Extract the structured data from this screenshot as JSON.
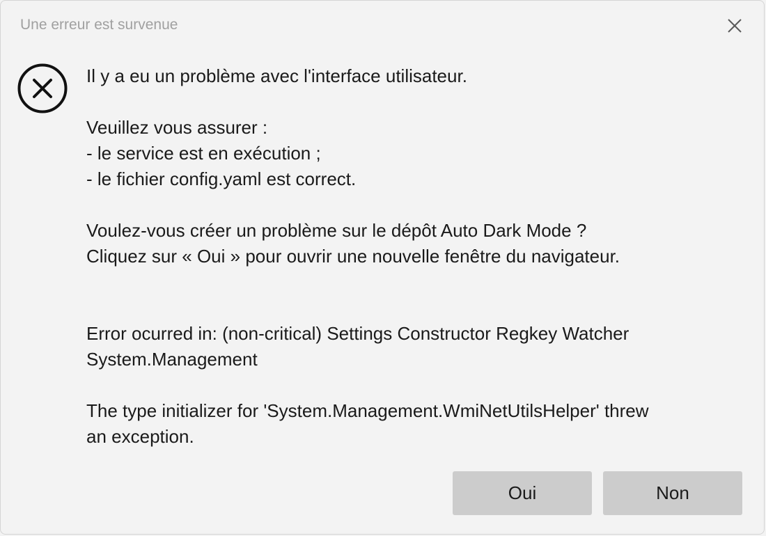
{
  "window": {
    "title": "Une erreur est survenue",
    "close_icon": "close-icon"
  },
  "icon": {
    "name": "error-circle-x-icon"
  },
  "message": {
    "line1": "Il y a eu un problème avec l'interface utilisateur.",
    "line2": "Veuillez vous assurer :",
    "line3": "- le service est en exécution ;",
    "line4": "- le fichier config.yaml est correct.",
    "line5": "Voulez-vous créer un problème sur le dépôt Auto Dark Mode ?",
    "line6": "Cliquez sur « Oui » pour ouvrir une nouvelle fenêtre du navigateur.",
    "line7": "Error ocurred in: (non-critical) Settings Constructor Regkey Watcher",
    "line8": "System.Management",
    "line9": "The type initializer for 'System.Management.WmiNetUtilsHelper' threw",
    "line10": "an exception."
  },
  "buttons": {
    "yes_label": "Oui",
    "no_label": "Non"
  },
  "colors": {
    "background": "#f3f3f3",
    "button": "#cccccc",
    "text": "#1a1a1a",
    "title_text": "#a0a0a0"
  }
}
